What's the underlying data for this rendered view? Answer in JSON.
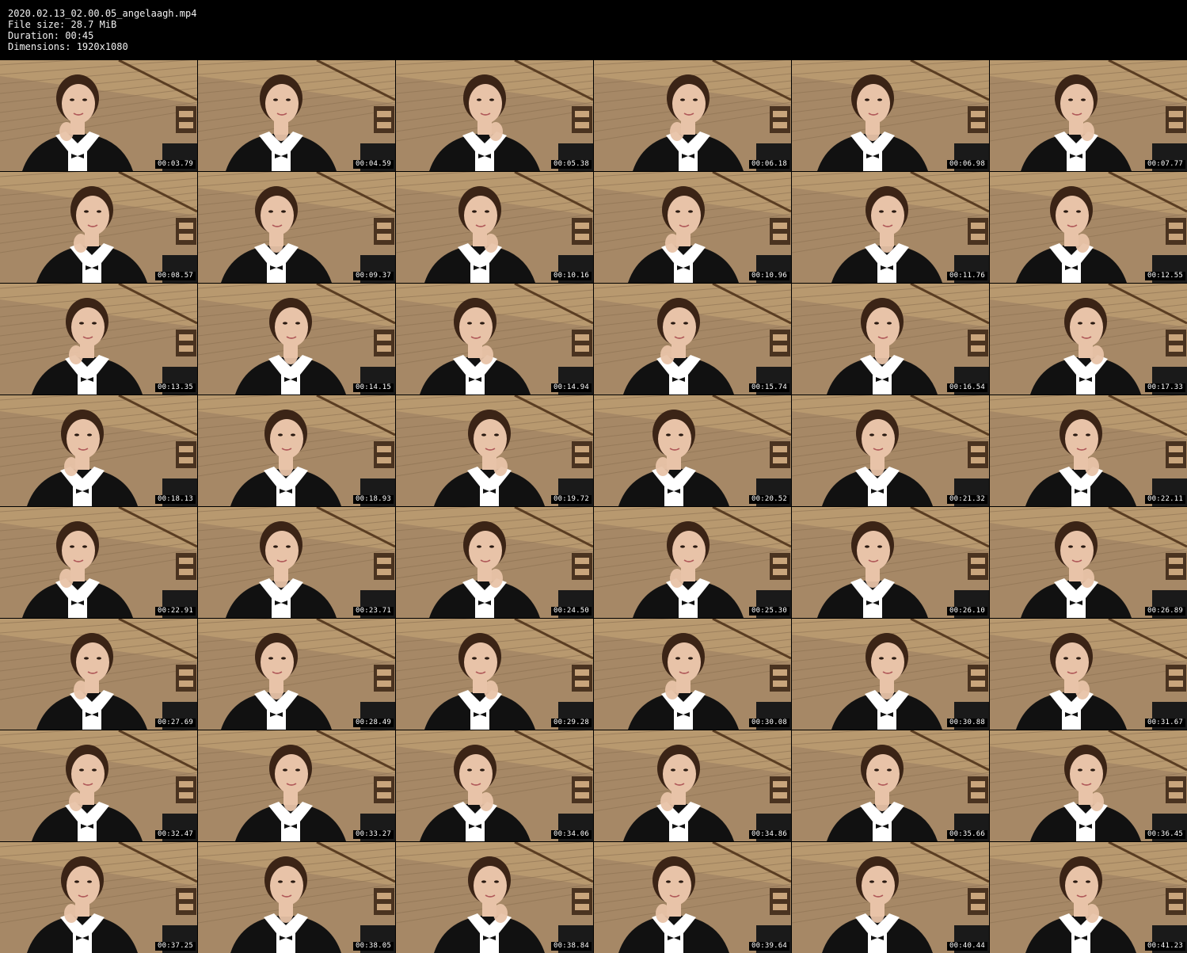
{
  "header": {
    "filename": "2020.02.13_02.00.05_angelaagh.mp4",
    "file_size": "File size: 28.7 MiB",
    "duration": "Duration: 00:45",
    "dimensions": "Dimensions: 1920x1080"
  },
  "thumbnails": [
    {
      "time": "00:03.79"
    },
    {
      "time": "00:04.59"
    },
    {
      "time": "00:05.38"
    },
    {
      "time": "00:06.18"
    },
    {
      "time": "00:06.98"
    },
    {
      "time": "00:07.77"
    },
    {
      "time": "00:08.57"
    },
    {
      "time": "00:09.37"
    },
    {
      "time": "00:10.16"
    },
    {
      "time": "00:10.96"
    },
    {
      "time": "00:11.76"
    },
    {
      "time": "00:12.55"
    },
    {
      "time": "00:13.35"
    },
    {
      "time": "00:14.15"
    },
    {
      "time": "00:14.94"
    },
    {
      "time": "00:15.74"
    },
    {
      "time": "00:16.54"
    },
    {
      "time": "00:17.33"
    },
    {
      "time": "00:18.13"
    },
    {
      "time": "00:18.93"
    },
    {
      "time": "00:19.72"
    },
    {
      "time": "00:20.52"
    },
    {
      "time": "00:21.32"
    },
    {
      "time": "00:22.11"
    },
    {
      "time": "00:22.91"
    },
    {
      "time": "00:23.71"
    },
    {
      "time": "00:24.50"
    },
    {
      "time": "00:25.30"
    },
    {
      "time": "00:26.10"
    },
    {
      "time": "00:26.89"
    },
    {
      "time": "00:27.69"
    },
    {
      "time": "00:28.49"
    },
    {
      "time": "00:29.28"
    },
    {
      "time": "00:30.08"
    },
    {
      "time": "00:30.88"
    },
    {
      "time": "00:31.67"
    },
    {
      "time": "00:32.47"
    },
    {
      "time": "00:33.27"
    },
    {
      "time": "00:34.06"
    },
    {
      "time": "00:34.86"
    },
    {
      "time": "00:35.66"
    },
    {
      "time": "00:36.45"
    },
    {
      "time": "00:37.25"
    },
    {
      "time": "00:38.05"
    },
    {
      "time": "00:38.84"
    },
    {
      "time": "00:39.64"
    },
    {
      "time": "00:40.44"
    },
    {
      "time": "00:41.23"
    }
  ],
  "colors": {
    "background": "#000000",
    "wall": "#a68866",
    "ceiling": "#b8996f",
    "shirt": "#ffffff",
    "dress": "#111111",
    "skin": "#e8c3a8",
    "hair": "#3b2416"
  }
}
